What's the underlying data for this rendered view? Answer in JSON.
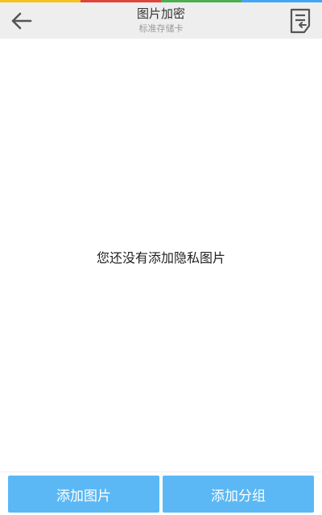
{
  "accent_colors": [
    "#f6c21c",
    "#e0443a",
    "#4caf50",
    "#42a5f5"
  ],
  "header": {
    "back_icon": "arrow-left-icon",
    "title": "图片加密",
    "subtitle": "标准存储卡",
    "menu_icon": "document-return-icon"
  },
  "main": {
    "empty_message": "您还没有添加隐私图片"
  },
  "bottom": {
    "add_image_label": "添加图片",
    "add_group_label": "添加分组",
    "button_color": "#5bb8f5"
  }
}
